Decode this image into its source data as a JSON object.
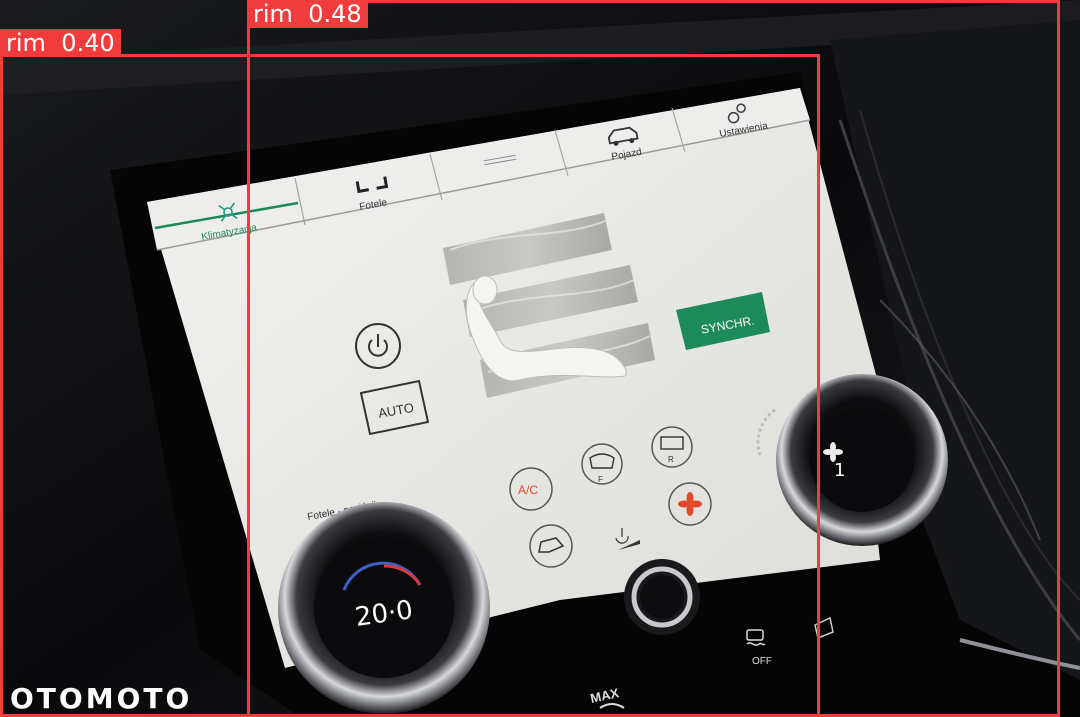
{
  "screen": {
    "tabs": [
      {
        "label": "Klimatyzacja",
        "icon": "climate-icon",
        "active": true
      },
      {
        "label": "Fotele",
        "icon": "seats-icon"
      },
      {
        "label": "",
        "icon": "handle-icon"
      },
      {
        "label": "Pojazd",
        "icon": "car-icon"
      },
      {
        "label": "Ustawienia",
        "icon": "gears-icon"
      }
    ],
    "power_icon": "power-icon",
    "auto_label": "AUTO",
    "synchr_label": "SYNCHR.",
    "seat_hint": "Fotele - naciśnij",
    "ac_label": "A/C",
    "front_defrost_label": "F",
    "rear_defrost_label": "R",
    "fan_icon": "fan-icon",
    "recirc_icon": "recirculation-icon",
    "colors": {
      "synchr": "#1d8a5c",
      "accent": "#e04a2e",
      "screen": "#e9e9e6"
    }
  },
  "left_knob": {
    "temperature": "20·0"
  },
  "right_knob": {
    "fan_level": "1",
    "icon": "fan-icon"
  },
  "console": {
    "drive_off_label": "OFF",
    "max_label": "MAX"
  },
  "detections": [
    {
      "label": "rim",
      "score": "0.40"
    },
    {
      "label": "rim",
      "score": "0.48"
    }
  ],
  "watermark": "OTOMOTO"
}
